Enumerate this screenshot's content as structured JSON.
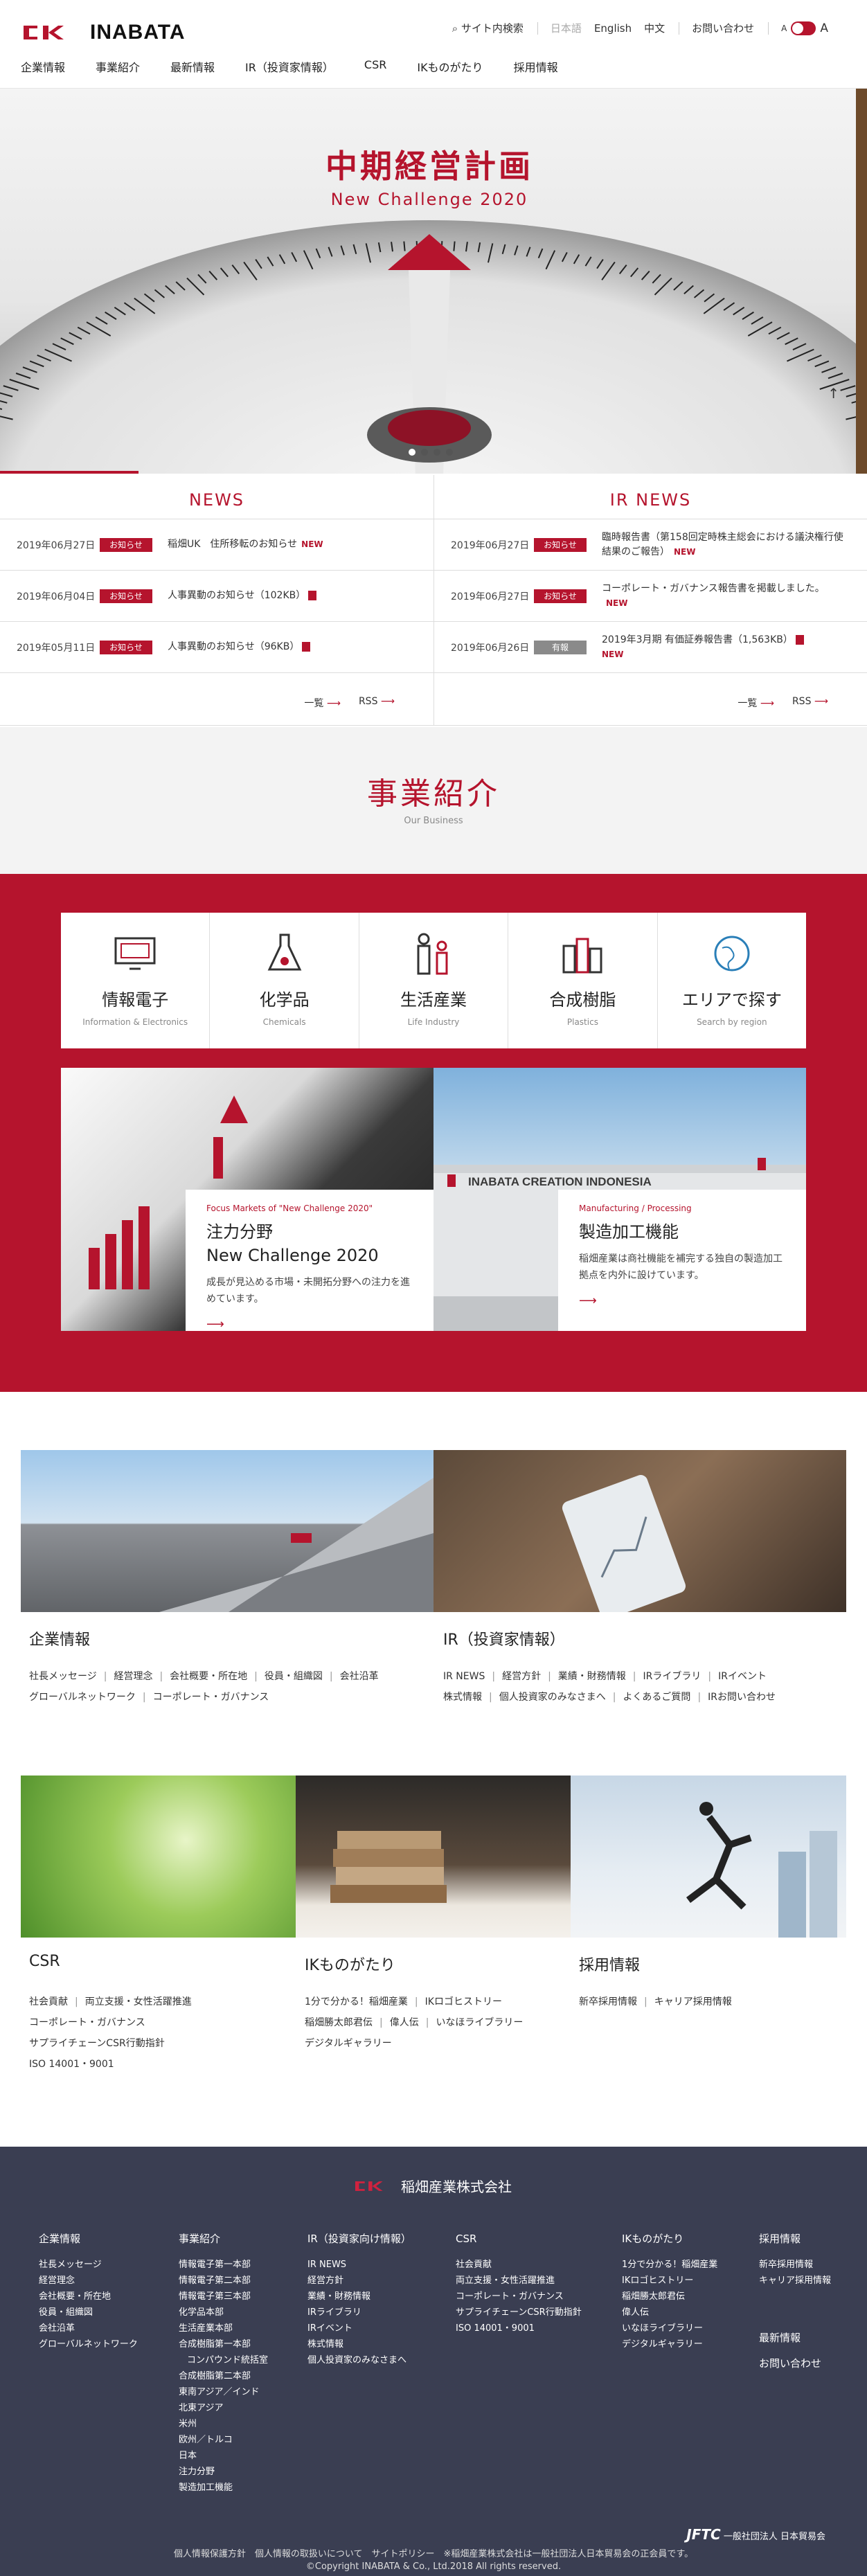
{
  "header": {
    "brand": "INABATA",
    "search_label": "サイト内検索",
    "lang_jp": "日本語",
    "lang_en": "English",
    "lang_cn": "中文",
    "contact": "お問い合わせ",
    "font_small": "A",
    "font_large": "A",
    "nav": [
      "企業情報",
      "事業紹介",
      "最新情報",
      "IR（投資家情報）",
      "CSR",
      "IKものがたり",
      "採用情報"
    ]
  },
  "hero": {
    "title": "中期経営計画",
    "subtitle": "New Challenge 2020",
    "slide_count": 4,
    "active_slide": 1
  },
  "news": {
    "title": "NEWS",
    "items": [
      {
        "date": "2019年06月27日",
        "tag": "お知らせ",
        "text": "稲畑UK　住所移転のお知らせ",
        "new": "NEW"
      },
      {
        "date": "2019年06月04日",
        "tag": "お知らせ",
        "text": "人事異動のお知らせ（102KB）"
      },
      {
        "date": "2019年05月11日",
        "tag": "お知らせ",
        "text": "人事異動のお知らせ（96KB）"
      }
    ],
    "list_link": "一覧",
    "rss_link": "RSS"
  },
  "ir_news": {
    "title": "IR NEWS",
    "items": [
      {
        "date": "2019年06月27日",
        "tag": "お知らせ",
        "text": "臨時報告書（第158回定時株主総会における議決権行使結果のご報告）",
        "new": "NEW"
      },
      {
        "date": "2019年06月27日",
        "tag": "お知らせ",
        "text": "コーポレート・ガバナンス報告書を掲載しました。",
        "new": "NEW"
      },
      {
        "date": "2019年06月26日",
        "tag": "有報",
        "text": "2019年3月期 有価証券報告書（1,563KB）",
        "new": "NEW"
      }
    ],
    "list_link": "一覧",
    "rss_link": "RSS"
  },
  "business": {
    "title": "事業紹介",
    "subtitle": "Our Business",
    "categories": [
      {
        "jp": "情報電子",
        "en": "Information & Electronics",
        "icon": "monitor-icon"
      },
      {
        "jp": "化学品",
        "en": "Chemicals",
        "icon": "flask-icon"
      },
      {
        "jp": "生活産業",
        "en": "Life Industry",
        "icon": "family-icon"
      },
      {
        "jp": "合成樹脂",
        "en": "Plastics",
        "icon": "bottles-icon"
      },
      {
        "jp": "エリアで探す",
        "en": "Search by region",
        "icon": "globe-icon"
      }
    ],
    "feature1": {
      "en": "Focus Markets of \"New Challenge 2020\"",
      "jp1": "注力分野",
      "jp2": "New Challenge 2020",
      "desc": "成長が見込める市場・未開拓分野への注力を進めています。",
      "arrow": "⟶"
    },
    "feature2": {
      "en": "Manufacturing / Processing",
      "jp1": "製造加工機能",
      "desc": "稲畑産業は商社機能を補完する独自の製造加工拠点を内外に設けています。",
      "arrow": "⟶",
      "sign": "INABATA CREATION INDONESIA"
    }
  },
  "corporate": {
    "title": "企業情報",
    "links1": [
      "社長メッセージ",
      "経営理念",
      "会社概要・所在地",
      "役員・組織図",
      "会社沿革"
    ],
    "links2": [
      "グローバルネットワーク",
      "コーポレート・ガバナンス"
    ]
  },
  "ir": {
    "title": "IR（投資家情報）",
    "links1": [
      "IR NEWS",
      "経営方針",
      "業績・財務情報",
      "IRライブラリ",
      "IRイベント"
    ],
    "links2": [
      "株式情報",
      "個人投資家のみなさまへ",
      "よくあるご質問",
      "IRお問い合わせ"
    ]
  },
  "csr": {
    "title": "CSR",
    "links1": [
      "社会貢献",
      "両立支援・女性活躍推進"
    ],
    "links2": [
      "コーポレート・ガバナンス"
    ],
    "links3": [
      "サプライチェーンCSR行動指針"
    ],
    "links4": [
      "ISO 14001・9001"
    ]
  },
  "story": {
    "title": "IKものがたり",
    "links1": [
      "1分で分かる！稲畑産業",
      "IKロゴヒストリー"
    ],
    "links2": [
      "稲畑勝太郎君伝",
      "偉人伝",
      "いなほライブラリー"
    ],
    "links3": [
      "デジタルギャラリー"
    ]
  },
  "recruit": {
    "title": "採用情報",
    "links1": [
      "新卒採用情報",
      "キャリア採用情報"
    ]
  },
  "footer": {
    "company": "稲畑産業株式会社",
    "col1": {
      "head": "企業情報",
      "items": [
        "社長メッセージ",
        "経営理念",
        "会社概要・所在地",
        "役員・組織図",
        "会社沿革",
        "グローバルネットワーク"
      ]
    },
    "col2": {
      "head": "事業紹介",
      "items": [
        "情報電子第一本部",
        "情報電子第二本部",
        "情報電子第三本部",
        "化学品本部",
        "生活産業本部",
        "合成樹脂第一本部",
        "コンパウンド統括室",
        "合成樹脂第二本部",
        "東南アジア／インド",
        "北東アジア",
        "米州",
        "欧州／トルコ",
        "日本",
        "注力分野",
        "製造加工機能"
      ]
    },
    "col3": {
      "head": "IR（投資家向け情報）",
      "items": [
        "IR NEWS",
        "経営方針",
        "業績・財務情報",
        "IRライブラリ",
        "IRイベント",
        "株式情報",
        "個人投資家のみなさまへ"
      ]
    },
    "col4": {
      "head": "CSR",
      "items": [
        "社会貢献",
        "両立支援・女性活躍推進",
        "コーポレート・ガバナンス",
        "サプライチェーンCSR行動指針",
        "ISO 14001・9001"
      ]
    },
    "col5": {
      "head": "IKものがたり",
      "items": [
        "1分で分かる！稲畑産業",
        "IKロゴヒストリー",
        "稲畑勝太郎君伝",
        "偉人伝",
        "いなほライブラリー",
        "デジタルギャラリー"
      ]
    },
    "col6": {
      "head": "採用情報",
      "items": [
        "新卒採用情報",
        "キャリア採用情報"
      ]
    },
    "col6b": {
      "head": "最新情報"
    },
    "col6c": {
      "head": "お問い合わせ"
    },
    "jftc": "一般社団法人 日本貿易会",
    "links": "個人情報保護方針　個人情報の取扱いについて　サイトポリシー　※稲畑産業株式会社は一般社団法人日本貿易会の正会員です。",
    "copyright": "©Copyright INABATA & Co., Ltd.2018 All rights reserved."
  }
}
